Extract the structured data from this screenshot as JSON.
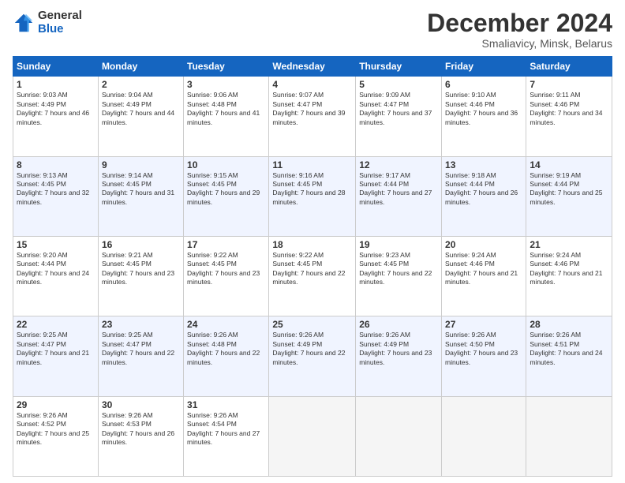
{
  "logo": {
    "line1": "General",
    "line2": "Blue"
  },
  "title": "December 2024",
  "subtitle": "Smaliavicy, Minsk, Belarus",
  "days_header": [
    "Sunday",
    "Monday",
    "Tuesday",
    "Wednesday",
    "Thursday",
    "Friday",
    "Saturday"
  ],
  "weeks": [
    [
      {
        "num": "1",
        "rise": "9:03 AM",
        "set": "4:49 PM",
        "daylight": "7 hours and 46 minutes."
      },
      {
        "num": "2",
        "rise": "9:04 AM",
        "set": "4:49 PM",
        "daylight": "7 hours and 44 minutes."
      },
      {
        "num": "3",
        "rise": "9:06 AM",
        "set": "4:48 PM",
        "daylight": "7 hours and 41 minutes."
      },
      {
        "num": "4",
        "rise": "9:07 AM",
        "set": "4:47 PM",
        "daylight": "7 hours and 39 minutes."
      },
      {
        "num": "5",
        "rise": "9:09 AM",
        "set": "4:47 PM",
        "daylight": "7 hours and 37 minutes."
      },
      {
        "num": "6",
        "rise": "9:10 AM",
        "set": "4:46 PM",
        "daylight": "7 hours and 36 minutes."
      },
      {
        "num": "7",
        "rise": "9:11 AM",
        "set": "4:46 PM",
        "daylight": "7 hours and 34 minutes."
      }
    ],
    [
      {
        "num": "8",
        "rise": "9:13 AM",
        "set": "4:45 PM",
        "daylight": "7 hours and 32 minutes."
      },
      {
        "num": "9",
        "rise": "9:14 AM",
        "set": "4:45 PM",
        "daylight": "7 hours and 31 minutes."
      },
      {
        "num": "10",
        "rise": "9:15 AM",
        "set": "4:45 PM",
        "daylight": "7 hours and 29 minutes."
      },
      {
        "num": "11",
        "rise": "9:16 AM",
        "set": "4:45 PM",
        "daylight": "7 hours and 28 minutes."
      },
      {
        "num": "12",
        "rise": "9:17 AM",
        "set": "4:44 PM",
        "daylight": "7 hours and 27 minutes."
      },
      {
        "num": "13",
        "rise": "9:18 AM",
        "set": "4:44 PM",
        "daylight": "7 hours and 26 minutes."
      },
      {
        "num": "14",
        "rise": "9:19 AM",
        "set": "4:44 PM",
        "daylight": "7 hours and 25 minutes."
      }
    ],
    [
      {
        "num": "15",
        "rise": "9:20 AM",
        "set": "4:44 PM",
        "daylight": "7 hours and 24 minutes."
      },
      {
        "num": "16",
        "rise": "9:21 AM",
        "set": "4:45 PM",
        "daylight": "7 hours and 23 minutes."
      },
      {
        "num": "17",
        "rise": "9:22 AM",
        "set": "4:45 PM",
        "daylight": "7 hours and 23 minutes."
      },
      {
        "num": "18",
        "rise": "9:22 AM",
        "set": "4:45 PM",
        "daylight": "7 hours and 22 minutes."
      },
      {
        "num": "19",
        "rise": "9:23 AM",
        "set": "4:45 PM",
        "daylight": "7 hours and 22 minutes."
      },
      {
        "num": "20",
        "rise": "9:24 AM",
        "set": "4:46 PM",
        "daylight": "7 hours and 21 minutes."
      },
      {
        "num": "21",
        "rise": "9:24 AM",
        "set": "4:46 PM",
        "daylight": "7 hours and 21 minutes."
      }
    ],
    [
      {
        "num": "22",
        "rise": "9:25 AM",
        "set": "4:47 PM",
        "daylight": "7 hours and 21 minutes."
      },
      {
        "num": "23",
        "rise": "9:25 AM",
        "set": "4:47 PM",
        "daylight": "7 hours and 22 minutes."
      },
      {
        "num": "24",
        "rise": "9:26 AM",
        "set": "4:48 PM",
        "daylight": "7 hours and 22 minutes."
      },
      {
        "num": "25",
        "rise": "9:26 AM",
        "set": "4:49 PM",
        "daylight": "7 hours and 22 minutes."
      },
      {
        "num": "26",
        "rise": "9:26 AM",
        "set": "4:49 PM",
        "daylight": "7 hours and 23 minutes."
      },
      {
        "num": "27",
        "rise": "9:26 AM",
        "set": "4:50 PM",
        "daylight": "7 hours and 23 minutes."
      },
      {
        "num": "28",
        "rise": "9:26 AM",
        "set": "4:51 PM",
        "daylight": "7 hours and 24 minutes."
      }
    ],
    [
      {
        "num": "29",
        "rise": "9:26 AM",
        "set": "4:52 PM",
        "daylight": "7 hours and 25 minutes."
      },
      {
        "num": "30",
        "rise": "9:26 AM",
        "set": "4:53 PM",
        "daylight": "7 hours and 26 minutes."
      },
      {
        "num": "31",
        "rise": "9:26 AM",
        "set": "4:54 PM",
        "daylight": "7 hours and 27 minutes."
      },
      null,
      null,
      null,
      null
    ]
  ]
}
